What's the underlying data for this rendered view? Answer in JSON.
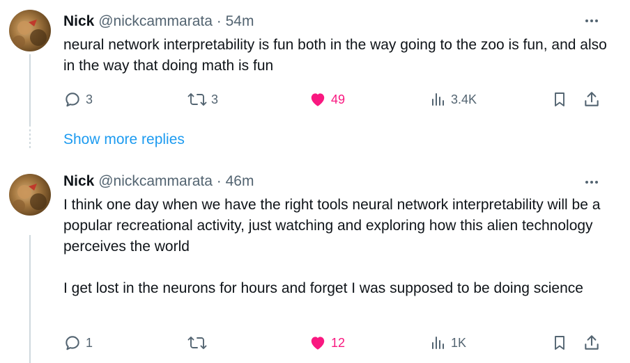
{
  "tweets": [
    {
      "author": {
        "name": "Nick",
        "handle": "@nickcammarata"
      },
      "separator": "·",
      "time": "54m",
      "text": "neural network interpretability is fun both in the way going to the zoo is fun, and also in the way that doing math is fun",
      "stats": {
        "replies": "3",
        "reposts": "3",
        "likes": "49",
        "views": "3.4K"
      },
      "liked": true
    },
    {
      "author": {
        "name": "Nick",
        "handle": "@nickcammarata"
      },
      "separator": "·",
      "time": "46m",
      "text": "I think one day when we have the right tools neural network interpretability will be a popular recreational activity, just watching and exploring how this alien technology perceives the world\n\nI get lost in the neurons for hours and forget I was supposed to be doing science",
      "stats": {
        "replies": "1",
        "reposts": "",
        "likes": "12",
        "views": "1K"
      },
      "liked": true
    }
  ],
  "show_more_label": "Show more replies",
  "colors": {
    "text": "#0f1419",
    "secondary": "#536471",
    "link": "#1d9bf0",
    "like": "#f91880",
    "thread_line": "#cfd9de"
  },
  "icons": [
    "reply-icon",
    "repost-icon",
    "like-icon",
    "views-icon",
    "bookmark-icon",
    "share-icon",
    "more-icon"
  ]
}
